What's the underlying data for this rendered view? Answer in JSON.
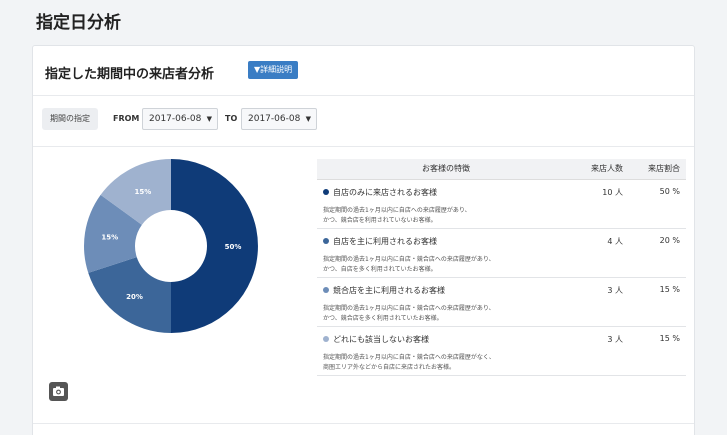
{
  "page": {
    "title": "指定日分析"
  },
  "card": {
    "title": "指定した期間中の来店者分析",
    "detail_button": "▼詳細説明"
  },
  "period": {
    "label": "期間の指定",
    "from_label": "FROM",
    "from_value": "2017-06-08",
    "to_label": "TO",
    "to_value": "2017-06-08"
  },
  "table": {
    "headers": [
      "お客様の特徴",
      "来店人数",
      "来店割合"
    ],
    "rows": [
      {
        "title": "自店のみに来店されるお客様",
        "desc1": "指定期間の過去1ヶ月以内に自店への来店履歴があり、",
        "desc2": "かつ、競合店を利用されていないお客様。",
        "count": "10 人",
        "ratio": "50 %",
        "color": "#0f3b78"
      },
      {
        "title": "自店を主に利用されるお客様",
        "desc1": "指定期間の過去1ヶ月以内に自店・競合店への来店履歴があり、",
        "desc2": "かつ、自店を多く利用されていたお客様。",
        "count": "4 人",
        "ratio": "20 %",
        "color": "#3c6699"
      },
      {
        "title": "競合店を主に利用されるお客様",
        "desc1": "指定期間の過去1ヶ月以内に自店・競合店への来店履歴があり、",
        "desc2": "かつ、競合店を多く利用されていたお客様。",
        "count": "3 人",
        "ratio": "15 %",
        "color": "#6d8db8"
      },
      {
        "title": "どれにも該当しないお客様",
        "desc1": "指定期間の過去1ヶ月以内に自店・競合店への来店履歴がなく、",
        "desc2": "商圏エリア外などから自店に来店されたお客様。",
        "count": "3 人",
        "ratio": "15 %",
        "color": "#9fb2cf"
      }
    ]
  },
  "chart_data": {
    "type": "pie",
    "donut": true,
    "categories": [
      "自店のみに来店されるお客様",
      "自店を主に利用されるお客様",
      "競合店を主に利用されるお客様",
      "どれにも該当しないお客様"
    ],
    "values": [
      50,
      20,
      15,
      15
    ],
    "labels": [
      "50%",
      "20%",
      "15%",
      "15%"
    ],
    "colors": [
      "#0f3b78",
      "#3c6699",
      "#6d8db8",
      "#9fb2cf"
    ]
  },
  "icons": {
    "camera": "camera-icon",
    "dropdown": "caret-down-icon"
  }
}
